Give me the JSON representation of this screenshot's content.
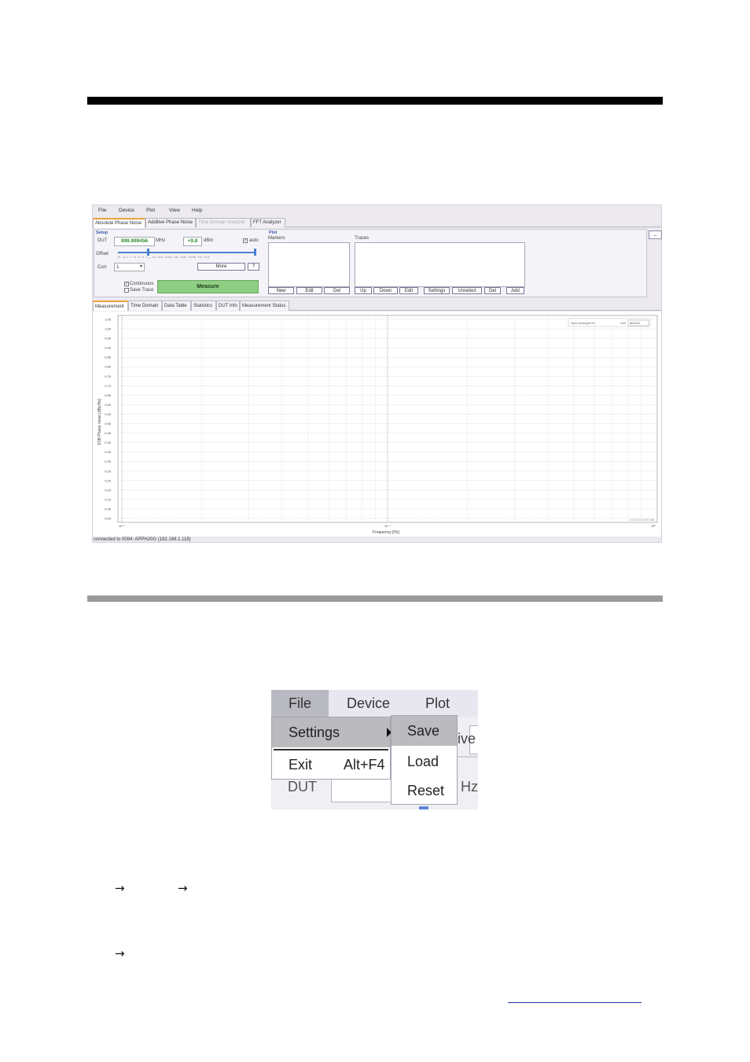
{
  "app": {
    "menu": [
      "File",
      "Device",
      "Plot",
      "View",
      "Help"
    ],
    "top_tabs": [
      "Absolute Phase Noise",
      "Additive Phase Noise",
      "Time Domain Analyzer",
      "FFT Analyzer"
    ],
    "minimize_label": "_",
    "setup": {
      "section_label": "Setup",
      "dut_label": "DUT",
      "dut_freq": "999.999456",
      "dut_freq_unit": "MHz",
      "dut_power": "+9.8",
      "dut_power_unit": "dBm",
      "auto_label": "auto",
      "offset_label": "Offset",
      "offset_ticks": "-½ -¼ 1 1 ½ ¼ ⅛ ¹⁄₁₆ 1k 10k 100k 1M 10M 100M 1G 10G",
      "corr_label": "Corr",
      "corr_value": "1",
      "more_label": "More",
      "help_label": "?",
      "continuous_label": "Continuous",
      "save_trace_label": "Save Trace",
      "measure_label": "Measure"
    },
    "plot": {
      "section_label": "Plot",
      "markers_label": "Markers",
      "traces_label": "Traces",
      "marker_buttons": [
        "New",
        "Edit",
        "Del"
      ],
      "trace_buttons": [
        "Up",
        "Down",
        "Edit",
        "Settings",
        "Unselect",
        "Del",
        "Add"
      ]
    },
    "sub_tabs": [
      "Measurement",
      "Time Domain",
      "Data Table",
      "Statistics",
      "DUT Info",
      "Measurement Status"
    ],
    "chart": {
      "y_axis_label": "SSB Phase noise [dBc/Hz]",
      "x_axis_label": "Frequency [Hz]",
      "y_ticks": [
        "1.05",
        "1.00",
        "0.95",
        "0.90",
        "0.85",
        "0.80",
        "0.75",
        "0.70",
        "0.65",
        "0.60",
        "0.55",
        "0.50",
        "0.45",
        "0.40",
        "0.35",
        "0.30",
        "0.25",
        "0.20",
        "0.15",
        "0.10",
        "0.05",
        "0.00"
      ],
      "x_ticks": [
        "10⁻²",
        "10⁻¹",
        "10⁰"
      ],
      "legend_select": "Spot (changed 0)",
      "legend_unit_label": "Unit",
      "legend_unit_value": "dBc/Hz",
      "timestamp": "1/1/2013 6:50 AM"
    },
    "status_bar": "connected to 0094: APPH20G (192.168.1.118)"
  },
  "zoom": {
    "menubar": [
      "File",
      "Device",
      "Plot"
    ],
    "behind_texts": [
      "ive",
      "Hz"
    ],
    "dut_label": "DUT",
    "dropdown": [
      {
        "label": "Settings",
        "shortcut": ""
      },
      {
        "label": "Exit",
        "shortcut": "Alt+F4"
      }
    ],
    "submenu": [
      "Save",
      "Load",
      "Reset"
    ]
  },
  "arrows": [
    "→",
    "→",
    "→"
  ]
}
